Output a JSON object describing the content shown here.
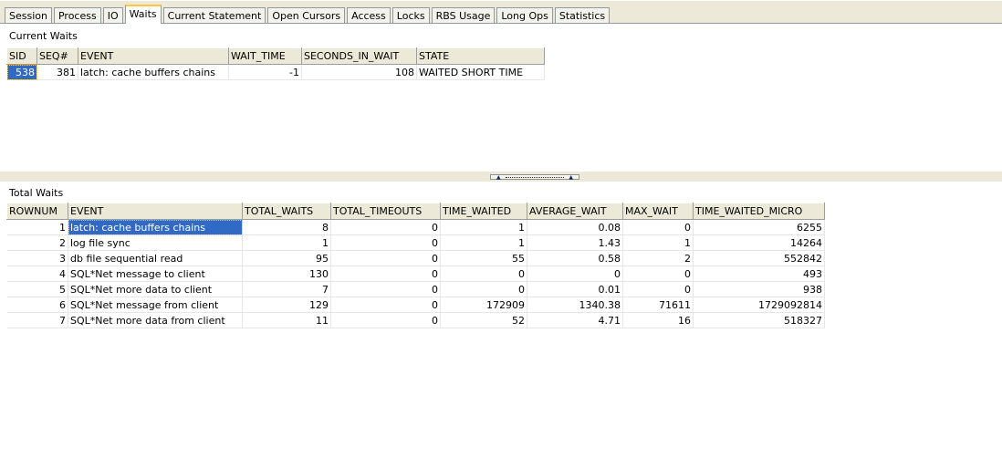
{
  "tabs": [
    {
      "label": "Session"
    },
    {
      "label": "Process"
    },
    {
      "label": "IO"
    },
    {
      "label": "Waits",
      "active": true
    },
    {
      "label": "Current Statement"
    },
    {
      "label": "Open Cursors"
    },
    {
      "label": "Access"
    },
    {
      "label": "Locks"
    },
    {
      "label": "RBS Usage"
    },
    {
      "label": "Long Ops"
    },
    {
      "label": "Statistics"
    }
  ],
  "current_waits": {
    "title": "Current Waits",
    "columns": [
      "SID",
      "SEQ#",
      "EVENT",
      "WAIT_TIME",
      "SECONDS_IN_WAIT",
      "STATE"
    ],
    "rows": [
      [
        "538",
        "381",
        "latch: cache buffers chains",
        "-1",
        "108",
        "WAITED SHORT TIME"
      ]
    ]
  },
  "total_waits": {
    "title": "Total Waits",
    "columns": [
      "ROWNUM",
      "EVENT",
      "TOTAL_WAITS",
      "TOTAL_TIMEOUTS",
      "TIME_WAITED",
      "AVERAGE_WAIT",
      "MAX_WAIT",
      "TIME_WAITED_MICRO"
    ],
    "rows": [
      [
        "1",
        "latch: cache buffers chains",
        "8",
        "0",
        "1",
        "0.08",
        "0",
        "6255"
      ],
      [
        "2",
        "log file sync",
        "1",
        "0",
        "1",
        "1.43",
        "1",
        "14264"
      ],
      [
        "3",
        "db file sequential read",
        "95",
        "0",
        "55",
        "0.58",
        "2",
        "552842"
      ],
      [
        "4",
        "SQL*Net message to client",
        "130",
        "0",
        "0",
        "0",
        "0",
        "493"
      ],
      [
        "5",
        "SQL*Net more data to client",
        "7",
        "0",
        "0",
        "0.01",
        "0",
        "938"
      ],
      [
        "6",
        "SQL*Net message from client",
        "129",
        "0",
        "172909",
        "1340.38",
        "71611",
        "1729092814"
      ],
      [
        "7",
        "SQL*Net more data from client",
        "11",
        "0",
        "52",
        "4.71",
        "16",
        "518327"
      ]
    ]
  },
  "colors": {
    "selection": "#316ac5",
    "active_tab_accent": "#ffc83c",
    "chrome": "#ece9d8"
  }
}
